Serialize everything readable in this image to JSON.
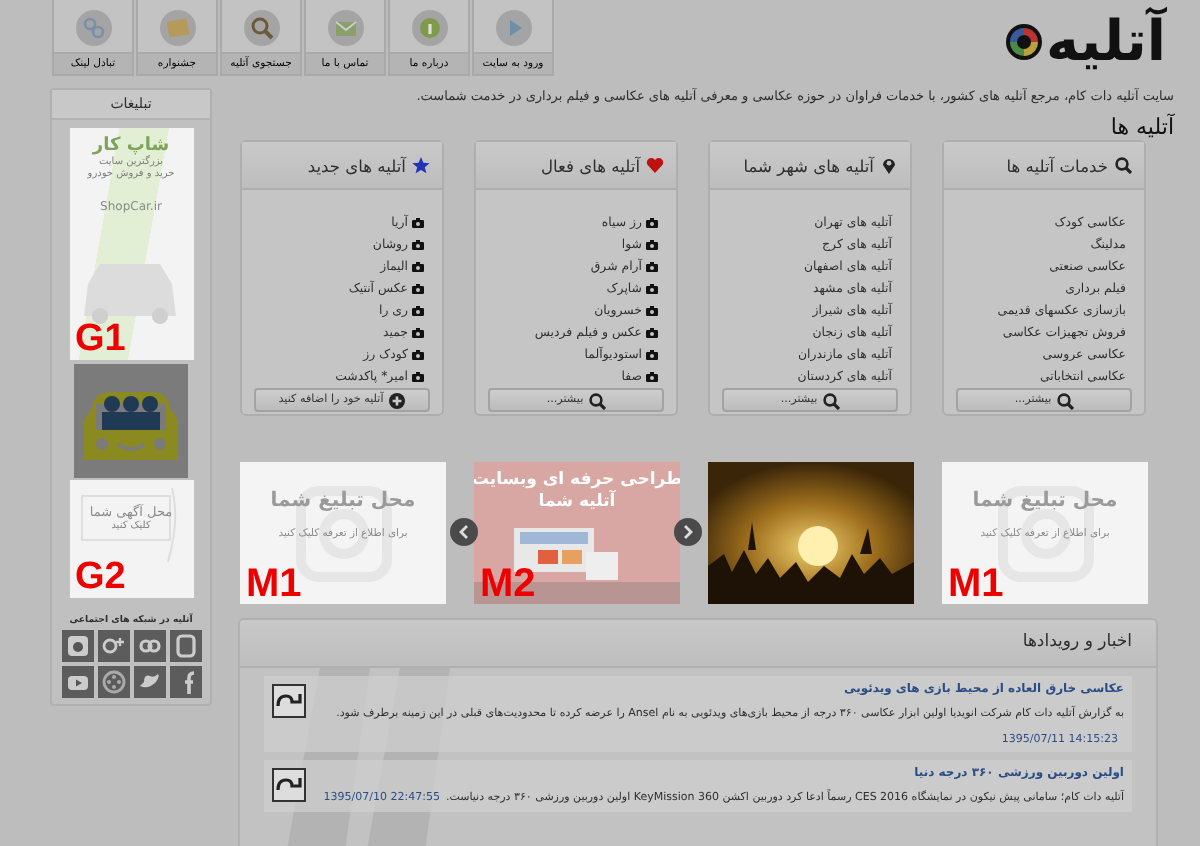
{
  "header": {
    "logo": "آتلیه",
    "nav": [
      {
        "label": "ورود به سایت",
        "kind": "play"
      },
      {
        "label": "درباره ما",
        "kind": "info"
      },
      {
        "label": "تماس با ما",
        "kind": "envelope"
      },
      {
        "label": "جستجوی آتلیه",
        "kind": "search"
      },
      {
        "label": "جشنواره",
        "kind": "picture"
      },
      {
        "label": "تبادل لینک",
        "kind": "link"
      }
    ]
  },
  "tagline": "سایت آتلیه دات کام، مرجع آتلیه های کشور، با خدمات فراوان در حوزه عکاسی و معرفی آتلیه های عکاسی و فیلم برداری در خدمت شماست.",
  "sidebar": {
    "title": "تبلیغات",
    "ads": [
      {
        "kind": "car-banner",
        "label": "G1",
        "texts": [
          "شاپ کار",
          "بزرگترین سایت",
          "خرید و فروش خودرو",
          "ShopCar.ir"
        ]
      },
      {
        "kind": "car-tile"
      },
      {
        "kind": "notice-banner",
        "label": "G2",
        "texts": [
          "محل آگهی شما",
          "کلیک کنید"
        ]
      }
    ],
    "social_title": "آتلیه در شبکه های اجتماعی",
    "social": [
      {
        "kind": "blogger"
      },
      {
        "kind": "infinity"
      },
      {
        "kind": "gplus"
      },
      {
        "kind": "instagram"
      },
      {
        "kind": "facebook"
      },
      {
        "kind": "twitter"
      },
      {
        "kind": "reel"
      },
      {
        "kind": "youtube"
      }
    ]
  },
  "section_title": "آتلیه ها",
  "boxes": [
    {
      "title": "خدمات آتلیه ها",
      "kind": "services",
      "items": [
        "عکاسی کودک",
        "مدلینگ",
        "عکاسی صنعتی",
        "فیلم برداری",
        "بازسازی عکسهای قدیمی",
        "فروش تجهیزات عکاسی",
        "عکاسی عروسی",
        "عکاسی انتخاباتی"
      ],
      "button": "بیشتر..."
    },
    {
      "title": "آتلیه های شهر شما",
      "kind": "cities",
      "items": [
        "آتلیه های تهران",
        "آتلیه های کرج",
        "آتلیه های اصفهان",
        "آتلیه های مشهد",
        "آتلیه های شیراز",
        "آتلیه های زنجان",
        "آتلیه های مازندران",
        "آتلیه های کردستان"
      ],
      "button": "بیشتر..."
    },
    {
      "title": "آتلیه های فعال",
      "kind": "active",
      "items": [
        "رز سیاه",
        "شوا",
        "آرام شرق",
        "شاپرک",
        "خسرویان",
        "عکس و فیلم فردیس",
        "استودیوآلما",
        "صفا"
      ],
      "button": "بیشتر..."
    },
    {
      "title": "آتلیه های جدید",
      "kind": "new",
      "items": [
        "آریا",
        "روشان",
        "الیماز",
        "عکس آنتیک",
        "ری را",
        "جمید",
        "کودک رز",
        "امیر* پاکدشت"
      ],
      "button": "آتلیه خود را اضافه کنید"
    }
  ],
  "carousel": [
    {
      "kind": "placeholder",
      "label": "M1",
      "texts": [
        "محل تبلیغ شما",
        "برای اطلاع از تعرفه کلیک کنید"
      ]
    },
    {
      "kind": "picture"
    },
    {
      "kind": "web",
      "label": "M2",
      "texts": [
        "طراحی حرفه ای وبسایت",
        "آتلیه شما"
      ]
    },
    {
      "kind": "placeholder",
      "label": "M1",
      "texts": [
        "محل تبلیغ شما",
        "برای اطلاع از تعرفه کلیک کنید"
      ]
    }
  ],
  "news": {
    "title": "اخبار و رویدادها",
    "items": [
      {
        "title": "عکاسی خارق العاده از محیط بازی های ویدئویی",
        "body": "به گزارش آتلیه دات کام شرکت انویدیا اولین ابزار عکاسی ۳۶۰ درجه از محیط بازی‌های ویدئویی به نام Ansel را عرضه کرده تا محدودیت‌های قبلی در این زمینه برطرف شود.",
        "date": "1395/07/11 14:15:23"
      },
      {
        "title": "اولین دوربین ورزشی ۳۶۰ درجه دنیا",
        "body": "آتلیه دات کام؛ سامانی پیش نیکون در نمایشگاه CES 2016 رسماً ادعا کرد دوربین اکشن KeyMission 360 اولین دوربین ورزشی ۳۶۰ درجه دنیاست.",
        "date": "1395/07/10 22:47:55"
      }
    ]
  }
}
